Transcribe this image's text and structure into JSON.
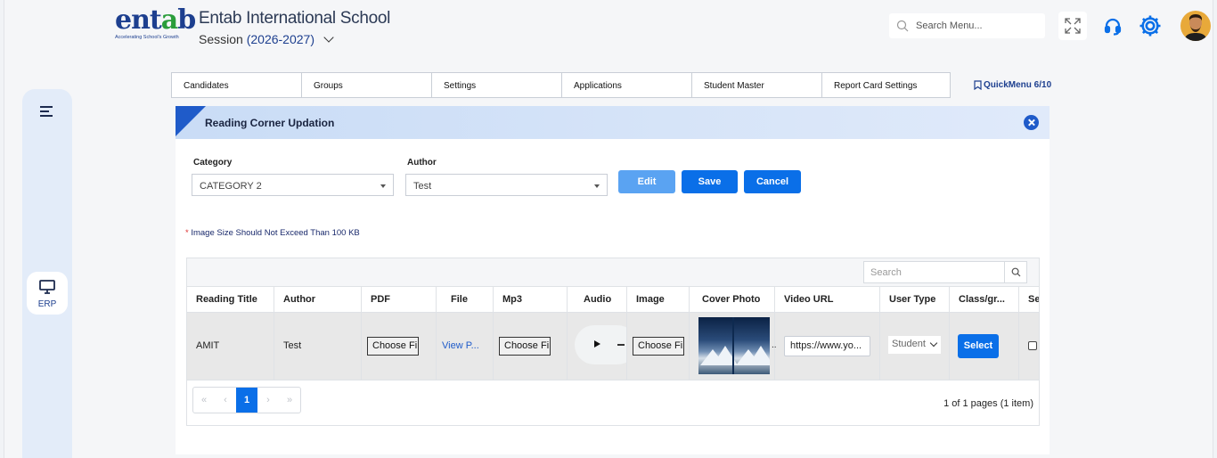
{
  "header": {
    "logo_word": "entab",
    "logo_tagline": "Accelerating School's Growth",
    "school_name": "Entab International School",
    "session_label": "Session",
    "session_year": "(2026-2027)",
    "search_placeholder": "Search Menu..."
  },
  "sidebar": {
    "erp_label": "ERP"
  },
  "nav": {
    "tabs": [
      "Candidates",
      "Groups",
      "Settings",
      "Applications",
      "Student Master",
      "Report Card Settings"
    ],
    "quickmenu": "QuickMenu 6/10"
  },
  "panel": {
    "title": "Reading Corner Updation",
    "category_label": "Category",
    "category_value": "CATEGORY 2",
    "author_label": "Author",
    "author_value": "Test",
    "edit_label": "Edit",
    "save_label": "Save",
    "cancel_label": "Cancel",
    "note_star": "*",
    "note": "Image Size Should Not Exceed Than 100 KB"
  },
  "grid": {
    "search_placeholder": "Search",
    "columns": [
      "Reading Title",
      "Author",
      "PDF",
      "File",
      "Mp3",
      "Audio",
      "Image",
      "Cover Photo",
      "Video URL",
      "User Type",
      "Class/gr...",
      "Se..."
    ],
    "row": {
      "reading_title": "AMIT",
      "author": "Test",
      "pdf_button": "Choose Fi",
      "file_link": "View P...",
      "mp3_button": "Choose Fi",
      "image_button": "Choose Fi",
      "cover_ellipsis": "..",
      "video_url": "https://www.yo...",
      "user_type": "Student",
      "select_label": "Select"
    },
    "pager": {
      "first": "«",
      "prev": "‹",
      "page": "1",
      "next": "›",
      "last": "»"
    },
    "page_info": "1 of 1 pages (1 item)"
  },
  "colors": {
    "primary": "#0a6fe8",
    "brand_blue": "#1d3f8f",
    "brand_green": "#2a9d3a",
    "header_gradient": "#c9dcf6"
  }
}
